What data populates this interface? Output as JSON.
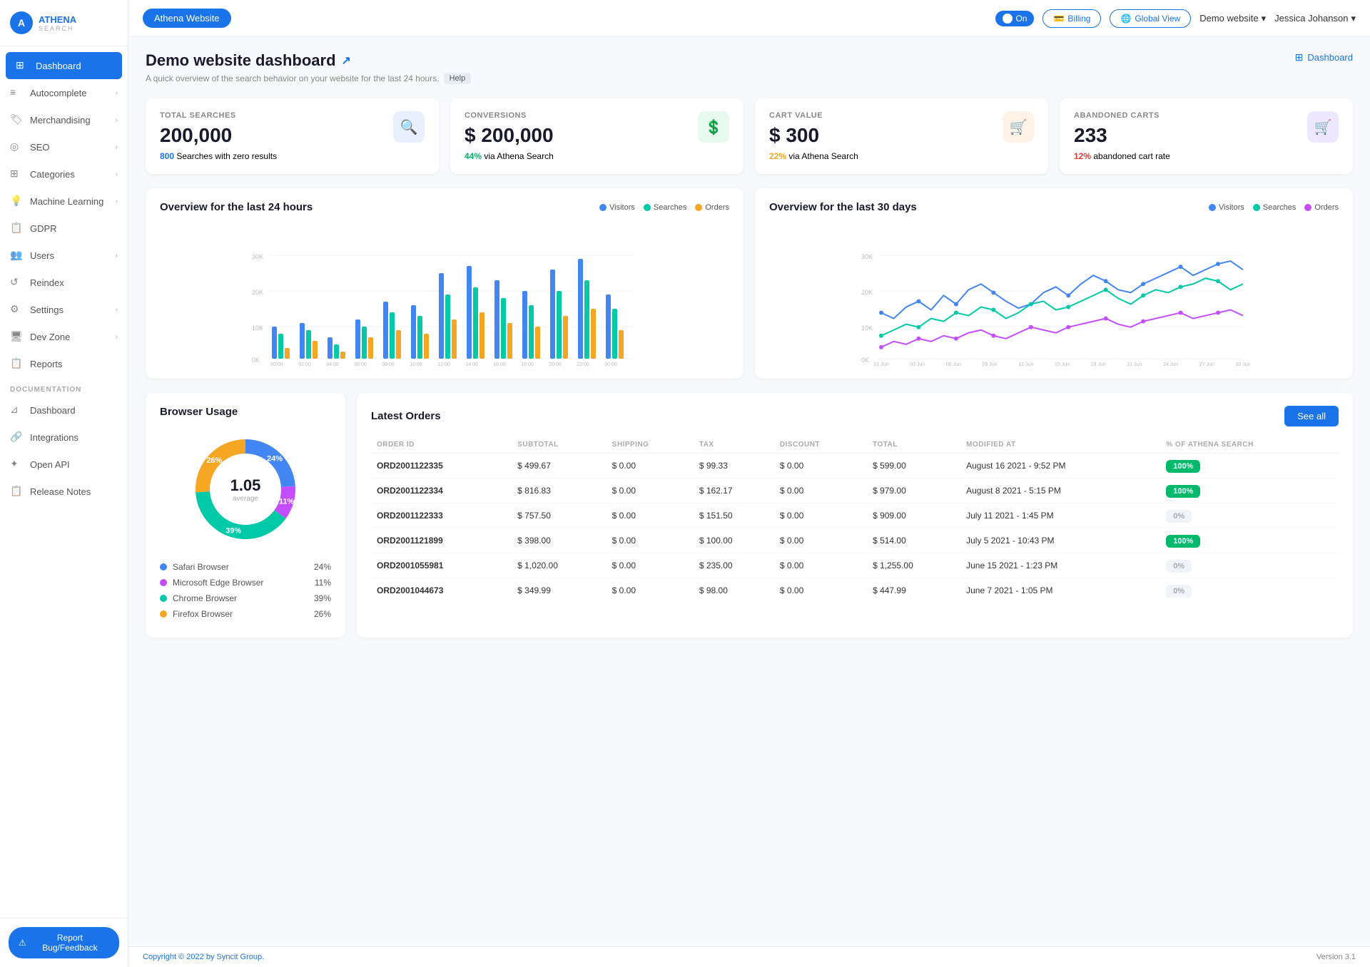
{
  "sidebar": {
    "logo": {
      "text": "ATHENA",
      "sub": "SEARCH"
    },
    "nav": [
      {
        "id": "dashboard",
        "label": "Dashboard",
        "icon": "⊞",
        "active": true,
        "hasChevron": false
      },
      {
        "id": "autocomplete",
        "label": "Autocomplete",
        "icon": "☰",
        "active": false,
        "hasChevron": true
      },
      {
        "id": "merchandising",
        "label": "Merchandising",
        "icon": "🏷",
        "active": false,
        "hasChevron": true
      },
      {
        "id": "seo",
        "label": "SEO",
        "icon": "◎",
        "active": false,
        "hasChevron": true
      },
      {
        "id": "categories",
        "label": "Categories",
        "icon": "⊞",
        "active": false,
        "hasChevron": true
      },
      {
        "id": "ml",
        "label": "Machine Learning",
        "icon": "💡",
        "active": false,
        "hasChevron": true
      },
      {
        "id": "gdpr",
        "label": "GDPR",
        "icon": "🗒",
        "active": false,
        "hasChevron": false
      },
      {
        "id": "users",
        "label": "Users",
        "icon": "👥",
        "active": false,
        "hasChevron": true
      },
      {
        "id": "reindex",
        "label": "Reindex",
        "icon": "↺",
        "active": false,
        "hasChevron": false
      },
      {
        "id": "settings",
        "label": "Settings",
        "icon": "⚙",
        "active": false,
        "hasChevron": true
      },
      {
        "id": "devzone",
        "label": "Dev Zone",
        "icon": "🖥",
        "active": false,
        "hasChevron": true
      },
      {
        "id": "reports",
        "label": "Reports",
        "icon": "🗒",
        "active": false,
        "hasChevron": false
      }
    ],
    "documentation_label": "DOCUMENTATION",
    "doc_nav": [
      {
        "id": "doc-dashboard",
        "label": "Dashboard",
        "icon": "⊿",
        "hasChevron": false
      },
      {
        "id": "integrations",
        "label": "Integrations",
        "icon": "🔗",
        "hasChevron": false
      },
      {
        "id": "openapi",
        "label": "Open API",
        "icon": "✦",
        "hasChevron": false
      },
      {
        "id": "releasenotes",
        "label": "Release Notes",
        "icon": "🗒",
        "hasChevron": false
      }
    ],
    "report_bug_label": "Report Bug/Feedback"
  },
  "topbar": {
    "site_button": "Athena Website",
    "toggle_label": "On",
    "billing_label": "Billing",
    "global_label": "Global View",
    "site_selector": "Demo website",
    "user_selector": "Jessica Johanson"
  },
  "page": {
    "title": "Demo website dashboard",
    "subtitle": "A quick overview of the search behavior on your website for the last 24 hours.",
    "help_label": "Help",
    "breadcrumb": "Dashboard"
  },
  "kpis": [
    {
      "label": "TOTAL SEARCHES",
      "value": "200,000",
      "sub_highlight": "800",
      "sub_text": "Searches with zero results",
      "highlight_class": "highlight-blue",
      "icon_class": "search",
      "icon": "🔍"
    },
    {
      "label": "CONVERSIONS",
      "value": "$ 200,000",
      "sub_highlight": "44%",
      "sub_text": "via Athena Search",
      "highlight_class": "highlight-green",
      "icon_class": "conv",
      "icon": "💲"
    },
    {
      "label": "CART VALUE",
      "value": "$ 300",
      "sub_highlight": "22%",
      "sub_text": "via Athena Search",
      "highlight_class": "highlight-orange",
      "icon_class": "cart",
      "icon": "🛒"
    },
    {
      "label": "ABANDONED CARTS",
      "value": "233",
      "sub_highlight": "12%",
      "sub_text": "abandoned cart rate",
      "highlight_class": "highlight-red",
      "icon_class": "abandon",
      "icon": "🛒"
    }
  ],
  "chart24": {
    "title": "Overview for the last 24 hours",
    "legend": [
      {
        "label": "Visitors",
        "color": "#4285f4"
      },
      {
        "label": "Searches",
        "color": "#00c9a7"
      },
      {
        "label": "Orders",
        "color": "#f5a623"
      }
    ],
    "x_labels": [
      "00:00",
      "02:00",
      "04:00",
      "06:00",
      "08:00",
      "10:00",
      "12:00",
      "14:00",
      "16:00",
      "18:00",
      "20:00",
      "22:00",
      "00:00"
    ],
    "y_labels": [
      "0K",
      "10K",
      "20K",
      "30K"
    ]
  },
  "chart30": {
    "title": "Overview for the last 30 days",
    "legend": [
      {
        "label": "Visitors",
        "color": "#4285f4"
      },
      {
        "label": "Searches",
        "color": "#00c9a7"
      },
      {
        "label": "Orders",
        "color": "#c44dff"
      }
    ],
    "x_labels": [
      "01 Jun",
      "03 Jun",
      "06 Jun",
      "09 Jun",
      "12 Jun",
      "15 Jun",
      "18 Jun",
      "21 Jun",
      "24 Jun",
      "27 Jun",
      "30 Jun"
    ],
    "y_labels": [
      "0K",
      "10K",
      "20K",
      "30K"
    ]
  },
  "browser_usage": {
    "title": "Browser Usage",
    "average_value": "1.05",
    "average_label": "average",
    "browsers": [
      {
        "label": "Safari Browser",
        "percent": "24%",
        "color": "#4285f4"
      },
      {
        "label": "Microsoft Edge Browser",
        "percent": "11%",
        "color": "#c44dff"
      },
      {
        "label": "Chrome Browser",
        "percent": "39%",
        "color": "#00c9a7"
      },
      {
        "label": "Firefox Browser",
        "percent": "26%",
        "color": "#f5a623"
      }
    ],
    "donut_segments": [
      {
        "label": "Safari",
        "value": 24,
        "color": "#4285f4"
      },
      {
        "label": "Edge",
        "value": 11,
        "color": "#c44dff"
      },
      {
        "label": "Chrome",
        "value": 39,
        "color": "#00c9a7"
      },
      {
        "label": "Firefox",
        "value": 26,
        "color": "#f5a623"
      }
    ]
  },
  "orders": {
    "title": "Latest Orders",
    "see_all_label": "See all",
    "columns": [
      "ORDER ID",
      "SUBTOTAL",
      "SHIPPING",
      "TAX",
      "DISCOUNT",
      "TOTAL",
      "MODIFIED AT",
      "% OF ATHENA SEARCH"
    ],
    "rows": [
      {
        "id": "ORD2001122335",
        "subtotal": "$ 499.67",
        "shipping": "$ 0.00",
        "tax": "$ 99.33",
        "discount": "$ 0.00",
        "total": "$ 599.00",
        "modified": "August 16 2021 - 9:52 PM",
        "athena": "100%",
        "is_athena": true
      },
      {
        "id": "ORD2001122334",
        "subtotal": "$ 816.83",
        "shipping": "$ 0.00",
        "tax": "$ 162.17",
        "discount": "$ 0.00",
        "total": "$ 979.00",
        "modified": "August 8 2021 - 5:15 PM",
        "athena": "100%",
        "is_athena": true
      },
      {
        "id": "ORD2001122333",
        "subtotal": "$ 757.50",
        "shipping": "$ 0.00",
        "tax": "$ 151.50",
        "discount": "$ 0.00",
        "total": "$ 909.00",
        "modified": "July 11 2021 - 1:45 PM",
        "athena": "0%",
        "is_athena": false
      },
      {
        "id": "ORD2001121899",
        "subtotal": "$ 398.00",
        "shipping": "$ 0.00",
        "tax": "$ 100.00",
        "discount": "$ 0.00",
        "total": "$ 514.00",
        "modified": "July 5 2021 - 10:43 PM",
        "athena": "100%",
        "is_athena": true
      },
      {
        "id": "ORD2001055981",
        "subtotal": "$ 1,020.00",
        "shipping": "$ 0.00",
        "tax": "$ 235.00",
        "discount": "$ 0.00",
        "total": "$ 1,255.00",
        "modified": "June 15 2021 - 1:23 PM",
        "athena": "0%",
        "is_athena": false
      },
      {
        "id": "ORD2001044673",
        "subtotal": "$ 349.99",
        "shipping": "$ 0.00",
        "tax": "$ 98.00",
        "discount": "$ 0.00",
        "total": "$ 447.99",
        "modified": "June 7 2021 - 1:05 PM",
        "athena": "0%",
        "is_athena": false
      }
    ]
  },
  "footer": {
    "copyright": "Copyright © 2022 by Syncit Group.",
    "version": "Version 3.1"
  }
}
